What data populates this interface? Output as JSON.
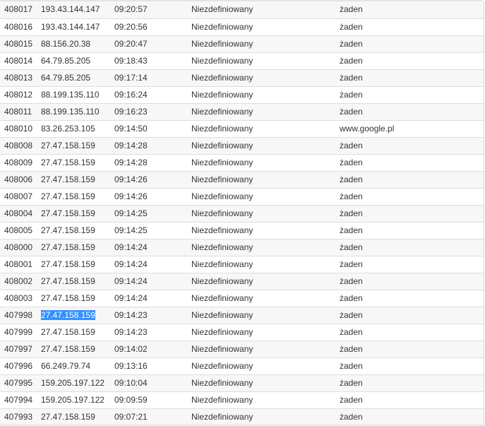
{
  "table": {
    "rows": [
      {
        "id": "408017",
        "ip": "193.43.144.147",
        "time": "09:20:57",
        "type": "Niezdefiniowany",
        "referrer": "żaden"
      },
      {
        "id": "408016",
        "ip": "193.43.144.147",
        "time": "09:20:56",
        "type": "Niezdefiniowany",
        "referrer": "żaden"
      },
      {
        "id": "408015",
        "ip": "88.156.20.38",
        "time": "09:20:47",
        "type": "Niezdefiniowany",
        "referrer": "żaden"
      },
      {
        "id": "408014",
        "ip": "64.79.85.205",
        "time": "09:18:43",
        "type": "Niezdefiniowany",
        "referrer": "żaden"
      },
      {
        "id": "408013",
        "ip": "64.79.85.205",
        "time": "09:17:14",
        "type": "Niezdefiniowany",
        "referrer": "żaden"
      },
      {
        "id": "408012",
        "ip": "88.199.135.110",
        "time": "09:16:24",
        "type": "Niezdefiniowany",
        "referrer": "żaden"
      },
      {
        "id": "408011",
        "ip": "88.199.135.110",
        "time": "09:16:23",
        "type": "Niezdefiniowany",
        "referrer": "żaden"
      },
      {
        "id": "408010",
        "ip": "83.26.253.105",
        "time": "09:14:50",
        "type": "Niezdefiniowany",
        "referrer": "www.google.pl"
      },
      {
        "id": "408008",
        "ip": "27.47.158.159",
        "time": "09:14:28",
        "type": "Niezdefiniowany",
        "referrer": "żaden"
      },
      {
        "id": "408009",
        "ip": "27.47.158.159",
        "time": "09:14:28",
        "type": "Niezdefiniowany",
        "referrer": "żaden"
      },
      {
        "id": "408006",
        "ip": "27.47.158.159",
        "time": "09:14:26",
        "type": "Niezdefiniowany",
        "referrer": "żaden"
      },
      {
        "id": "408007",
        "ip": "27.47.158.159",
        "time": "09:14:26",
        "type": "Niezdefiniowany",
        "referrer": "żaden"
      },
      {
        "id": "408004",
        "ip": "27.47.158.159",
        "time": "09:14:25",
        "type": "Niezdefiniowany",
        "referrer": "żaden"
      },
      {
        "id": "408005",
        "ip": "27.47.158.159",
        "time": "09:14:25",
        "type": "Niezdefiniowany",
        "referrer": "żaden"
      },
      {
        "id": "408000",
        "ip": "27.47.158.159",
        "time": "09:14:24",
        "type": "Niezdefiniowany",
        "referrer": "żaden"
      },
      {
        "id": "408001",
        "ip": "27.47.158.159",
        "time": "09:14:24",
        "type": "Niezdefiniowany",
        "referrer": "żaden"
      },
      {
        "id": "408002",
        "ip": "27.47.158.159",
        "time": "09:14:24",
        "type": "Niezdefiniowany",
        "referrer": "żaden"
      },
      {
        "id": "408003",
        "ip": "27.47.158.159",
        "time": "09:14:24",
        "type": "Niezdefiniowany",
        "referrer": "żaden"
      },
      {
        "id": "407998",
        "ip": "27.47.158.159",
        "time": "09:14:23",
        "type": "Niezdefiniowany",
        "referrer": "żaden",
        "ip_selected": true
      },
      {
        "id": "407999",
        "ip": "27.47.158.159",
        "time": "09:14:23",
        "type": "Niezdefiniowany",
        "referrer": "żaden"
      },
      {
        "id": "407997",
        "ip": "27.47.158.159",
        "time": "09:14:02",
        "type": "Niezdefiniowany",
        "referrer": "żaden"
      },
      {
        "id": "407996",
        "ip": "66.249.79.74",
        "time": "09:13:16",
        "type": "Niezdefiniowany",
        "referrer": "żaden"
      },
      {
        "id": "407995",
        "ip": "159.205.197.122",
        "time": "09:10:04",
        "type": "Niezdefiniowany",
        "referrer": "żaden"
      },
      {
        "id": "407994",
        "ip": "159.205.197.122",
        "time": "09:09:59",
        "type": "Niezdefiniowany",
        "referrer": "żaden"
      },
      {
        "id": "407993",
        "ip": "27.47.158.159",
        "time": "09:07:21",
        "type": "Niezdefiniowany",
        "referrer": "żaden"
      }
    ]
  },
  "colors": {
    "selection": "#3390ff",
    "row_alt": "#f7f7f7",
    "row_border": "#dddddd",
    "text": "#333333"
  }
}
